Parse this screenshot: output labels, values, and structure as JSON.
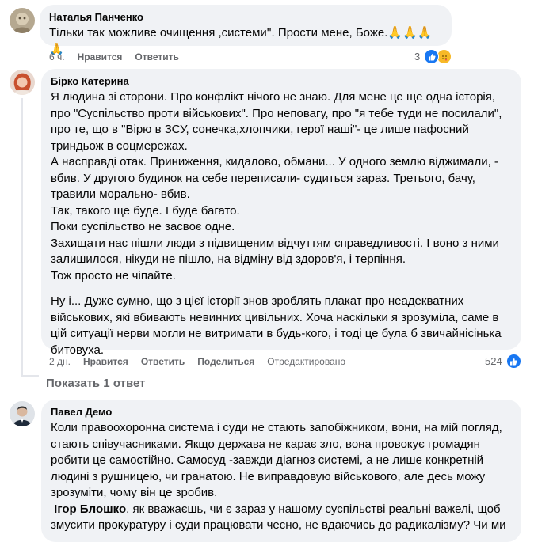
{
  "comments": [
    {
      "author": "Наталья Панченко",
      "text": "Тільки так можливе очищення ,системи''. Прости мене, Боже.🙏🙏🙏🙏",
      "time": "6 ч.",
      "like_label": "Нравится",
      "reply_label": "Ответить",
      "reaction_count": "3",
      "reaction_icons": [
        "like-icon",
        "care-icon"
      ]
    },
    {
      "author": "Бірко Катерина",
      "paragraphs": [
        "Я людина зі сторони. Про конфлікт нічого не знаю. Для мене це ще одна історія, про \"Суспільство проти військових\". Про неповагу, про \"я тебе туди не посилали\", про те, що в \"Вірю в ЗСУ, сонечка,хлопчики, герої наші\"- це лише пафосний триндьож в соцмережах.",
        "А насправді отак. Приниження, кидалово, обмани... У одного землю віджимали, - вбив. У другого будинок на себе переписали- судиться зараз. Третього, бачу, травили морально- вбив.",
        "Так, такого ще буде. І буде багато.",
        "Поки суспільство не засвоє одне.",
        "Захищати нас пішли люди з підвищеним відчуттям справедливості. І воно з ними залишилося, нікуди не пішло, на відміну від здоров'я, і терпіння.",
        "Тож просто не чіпайте."
      ],
      "paragraph2": "Ну і... Дуже сумно, що з цієї історії знов зроблять плакат про неадекватних військових, які вбивають невинних цивільних. Хоча наскільки я зрозуміла, саме в цій ситуації нерви могли не витримати в будь-кого, і тоді це була б звичайнісінька битовуха.",
      "time": "2 дн.",
      "like_label": "Нравится",
      "reply_label": "Ответить",
      "share_label": "Поделиться",
      "edited_label": "Отредактировано",
      "reaction_count": "524",
      "reaction_icons": [
        "like-icon"
      ]
    },
    {
      "author": "Павел Демо",
      "text": "Коли правоохоронна система і суди не стають запобіжником, вони, на мій погляд, стають співучасниками. Якщо держава не карає зло, вона провокує громадян робити це самостійно. Самосуд -завжди діагноз системі, а не лише конкретній людині з рушницею, чи гранатою. Не виправдовую військового, але десь можу зрозуміти, чому він це зробив.",
      "mention": "Ігор Блошко",
      "text2": ", як вважаєшь, чи є зараз у нашому суспільстві реальні важелі, щоб змусити прокуратуру і суди працювати чесно, не вдаючись до радикалізму? Чи ми"
    }
  ],
  "show_replies_label": "Показать 1 ответ"
}
